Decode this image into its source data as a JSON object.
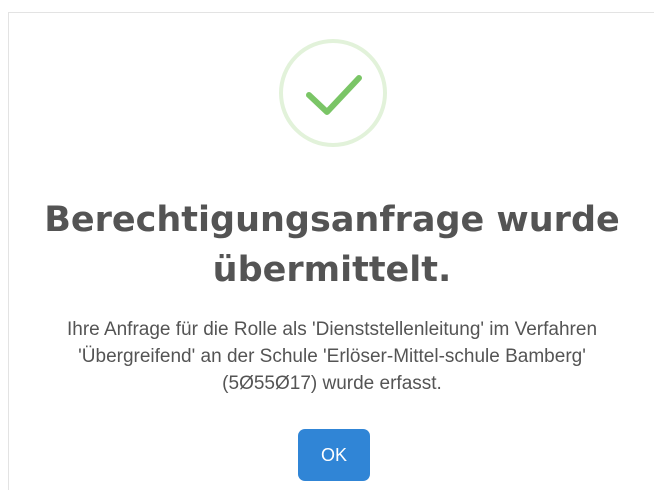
{
  "dialog": {
    "icon": "success-check-icon",
    "title": "Berechtigungsanfrage wurde übermittelt.",
    "message": "Ihre Anfrage für die Rolle als 'Dienststellenleitung' im Verfahren 'Übergreifend' an der Schule 'Erlöser-Mittel-schule Bamberg' (5Ø55Ø17) wurde erfasst.",
    "ok_label": "OK"
  },
  "colors": {
    "success": "#7ac566",
    "success_ring": "#e2f2da",
    "button": "#3085d6",
    "text": "#545454"
  }
}
